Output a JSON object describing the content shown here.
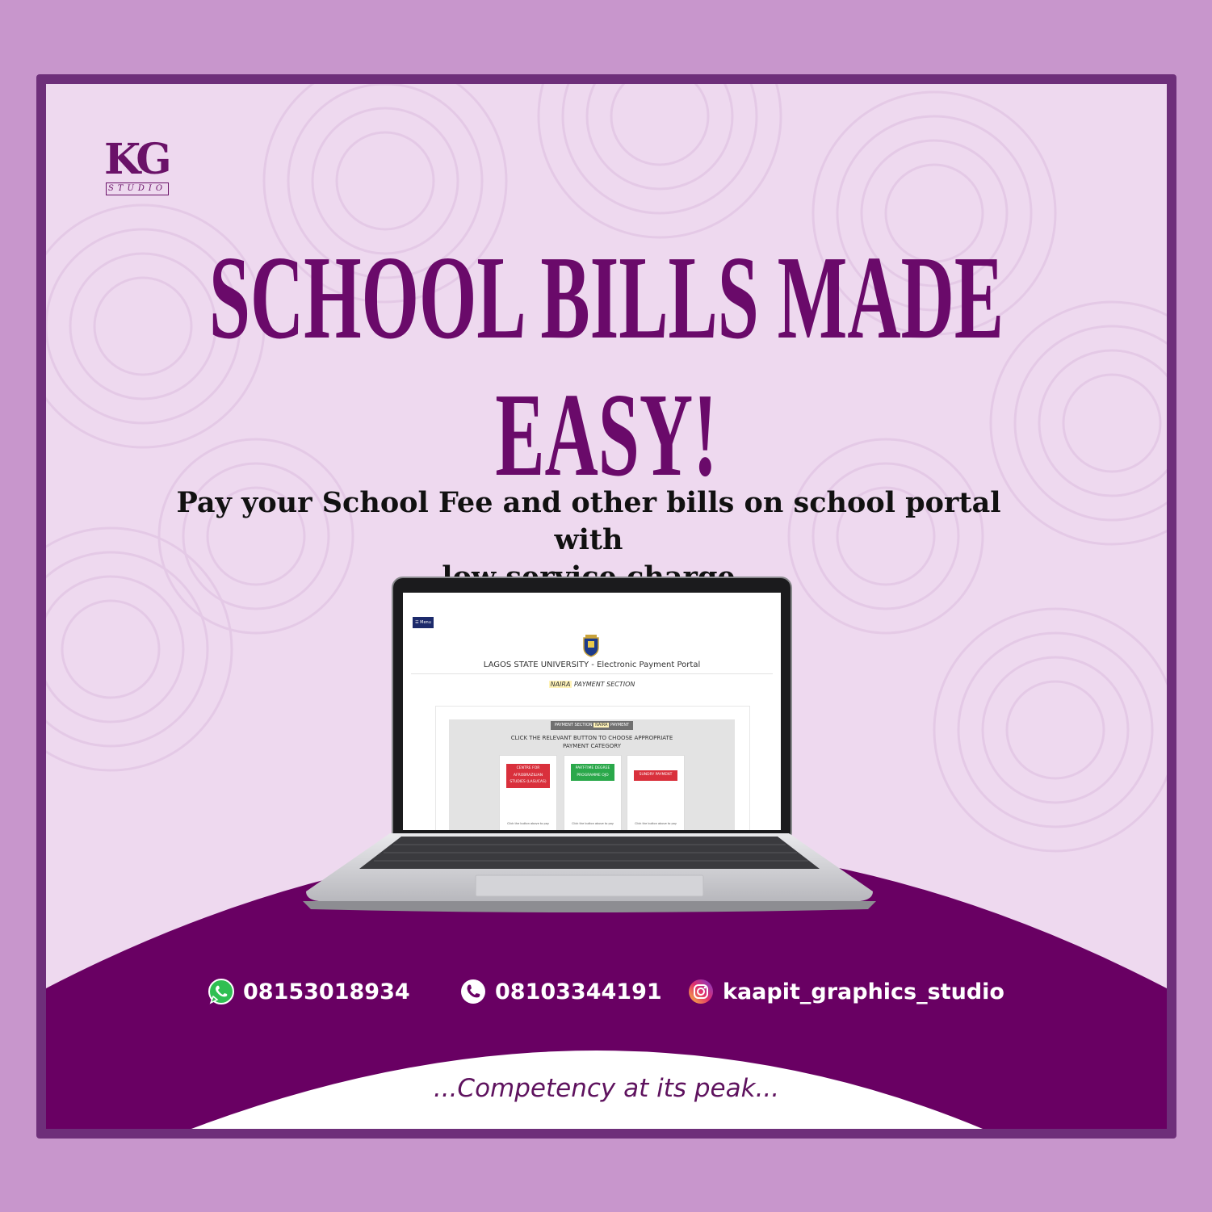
{
  "brand": {
    "logo_text": "KG",
    "logo_subtext": "STUDIO"
  },
  "headline": {
    "line1": "SCHOOL BILLS MADE",
    "line2": "EASY!"
  },
  "subtitle": {
    "line1": "Pay your School Fee and other bills on school portal with",
    "line2": "low service charge"
  },
  "portal": {
    "menu_label": "☰ Menu",
    "title": "LAGOS STATE UNIVERSITY - Electronic Payment Portal",
    "section_highlight": "NAIRA",
    "section_rest": " PAYMENT SECTION",
    "badge_pre": "PAYMENT SECTION ",
    "badge_highlight": "NAIRA",
    "badge_post": " PAYMENT",
    "instruction_line1": "CLICK THE RELEVANT BUTTON TO CHOOSE APPROPRIATE",
    "instruction_line2": "PAYMENT CATEGORY",
    "categories": [
      {
        "label": "CENTRE FOR AFROBRAZILIAN STUDIES (LASUCAS)",
        "color": "#d9303c",
        "note": "Click the button above to pay"
      },
      {
        "label": "PART-TIME DEGREE PROGRAMME OJO",
        "color": "#2aa84a",
        "note": "Click the button above to pay"
      },
      {
        "label": "SUNDRY PAYMENT",
        "color": "#d9303c",
        "note": "Click the button above to pay"
      }
    ]
  },
  "contacts": {
    "whatsapp": "08153018934",
    "phone": "08103344191",
    "instagram": "kaapit_graphics_studio"
  },
  "slogan": "...Competency at its peak...",
  "colors": {
    "outer": "#c896cc",
    "frame": "#6e2f7a",
    "panel": "#eed9ef",
    "brand_purple": "#6a0a6a",
    "dome_purple": "#690063"
  }
}
